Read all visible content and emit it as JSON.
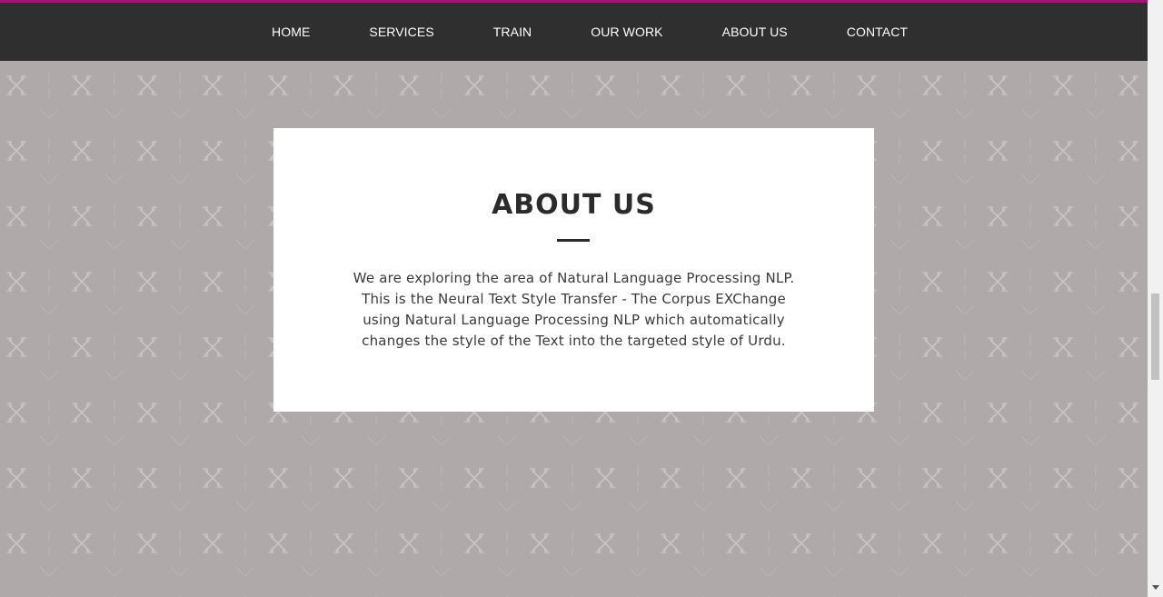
{
  "nav": {
    "items": [
      {
        "label": "HOME"
      },
      {
        "label": "SERVICES"
      },
      {
        "label": "TRAIN"
      },
      {
        "label": "OUR WORK"
      },
      {
        "label": "ABOUT US"
      },
      {
        "label": "CONTACT"
      }
    ]
  },
  "about": {
    "title": "ABOUT US",
    "body": "We are exploring the area of Natural Language Processing NLP. This is the Neural Text Style Transfer - The Corpus EXChange using Natural Language Processing NLP which automatically changes the style of the Text into the targeted style of Urdu."
  },
  "colors": {
    "accent": "#a2147d",
    "nav_background": "#2f2f2f",
    "page_background": "#afaaa9",
    "card_background": "#ffffff"
  },
  "icons": {
    "background_pattern": "tools-pattern-icon"
  }
}
